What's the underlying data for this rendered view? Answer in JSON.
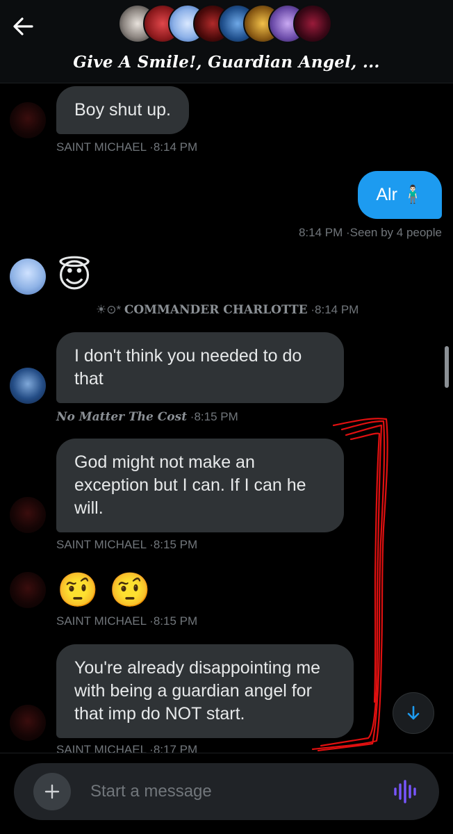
{
  "header": {
    "back_label": "Back",
    "group_title": "Give A Smile!, Guardian Angel, ..."
  },
  "messages": {
    "m1": {
      "text": "Boy shut up.",
      "sender": "SAINT MICHAEL",
      "time": "8:14 PM"
    },
    "m2": {
      "text": "Alr 🧍🏻‍♂️",
      "time": "8:14 PM",
      "seen": "Seen by 4 people"
    },
    "m3": {
      "emoji": "😇",
      "sender": "COMMANDER CHARLOTTE",
      "sender_prefix": "☀︎⊙*",
      "time": "8:14 PM"
    },
    "m4": {
      "text": "I don't think you needed to do that",
      "sender": "No Matter The Cost",
      "time": "8:15 PM"
    },
    "m5": {
      "text": "God might not make an exception but I can. If I can he will.",
      "sender": "SAINT MICHAEL",
      "time": "8:15 PM"
    },
    "m6": {
      "emoji": "🤨 🤨",
      "sender": "SAINT MICHAEL",
      "time": "8:15 PM"
    },
    "m7": {
      "text": "You're already disappointing me with being a guardian angel for that imp do NOT start.",
      "sender": "SAINT MICHAEL",
      "time": "8:17 PM"
    }
  },
  "separator": "·",
  "composer": {
    "placeholder": "Start a message"
  },
  "colors": {
    "accent": "#1d9bf0",
    "bubble_in": "#2f3336",
    "annotation": "#e01010",
    "voice": "#7856ff"
  },
  "icons": [
    "back-arrow-icon",
    "plus-icon",
    "voice-wave-icon",
    "arrow-down-icon"
  ]
}
